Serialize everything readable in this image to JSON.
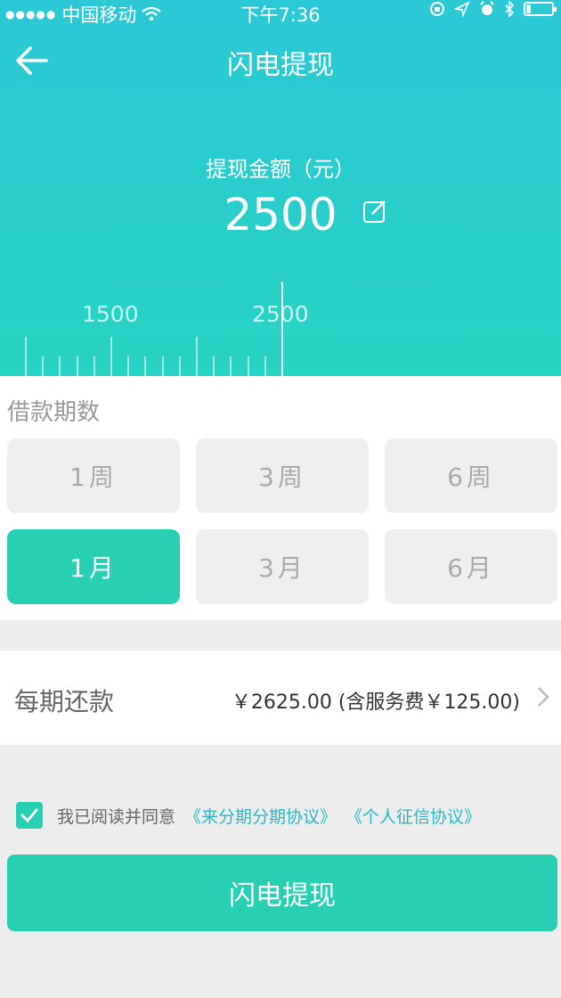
{
  "status_bar": {
    "signal_dots": "●●●●●",
    "carrier": "中国移动",
    "time": "下午7:36"
  },
  "header": {
    "title": "闪电提现"
  },
  "amount": {
    "label": "提现金额（元）",
    "value": "2500"
  },
  "ruler": {
    "labels": [
      "1500",
      "2500"
    ]
  },
  "term": {
    "title": "借款期数",
    "options": [
      {
        "label": "1周",
        "selected": false
      },
      {
        "label": "3周",
        "selected": false
      },
      {
        "label": "6周",
        "selected": false
      },
      {
        "label": "1月",
        "selected": true
      },
      {
        "label": "3月",
        "selected": false
      },
      {
        "label": "6月",
        "selected": false
      }
    ]
  },
  "repayment": {
    "label": "每期还款",
    "value": "￥2625.00 (含服务费￥125.00)"
  },
  "agreement": {
    "checked": true,
    "text": "我已阅读并同意",
    "link1": "《来分期分期协议》",
    "link2": "《个人征信协议》"
  },
  "submit_label": "闪电提现",
  "colors": {
    "accent": "#27cfb3",
    "header_gradient_top": "#2bc8d6",
    "link": "#27b9c4"
  }
}
